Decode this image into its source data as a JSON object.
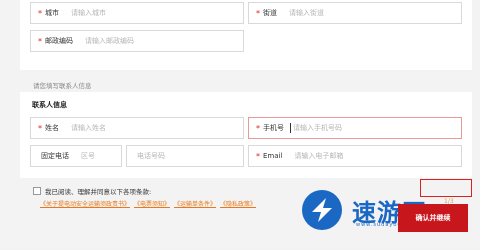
{
  "address": {
    "city": {
      "label": "城市",
      "placeholder": "请输入城市"
    },
    "street": {
      "label": "街道",
      "placeholder": "请输入街道"
    },
    "postcode": {
      "label": "邮政编码",
      "placeholder": "请输入邮政编码"
    }
  },
  "hint": "请您填写联系人信息",
  "contact": {
    "title": "联系人信息",
    "name": {
      "label": "姓名",
      "placeholder": "请输入姓名"
    },
    "phone": {
      "label": "手机号",
      "placeholder": "请输入手机号码"
    },
    "landline": {
      "label": "固定电话",
      "area_placeholder": "区号",
      "number_placeholder": "电话号码"
    },
    "email": {
      "label": "Email",
      "placeholder": "请输入电子邮箱"
    }
  },
  "agreement": {
    "text": "我已阅读、理解并同意以下各项条款:",
    "links": [
      "《关于提电动安全运输须政责书》",
      "《电票须知》",
      "《运输单条件》",
      "《隐私政策》"
    ]
  },
  "submit_label": "确认并继续",
  "highlight_text": "1/3",
  "watermark": {
    "title": "速游网",
    "url": "www.sudayou.com"
  },
  "colors": {
    "required": "#e02020",
    "submit": "#c8161d",
    "link": "#e8781a",
    "watermark": "#1a67c4"
  }
}
